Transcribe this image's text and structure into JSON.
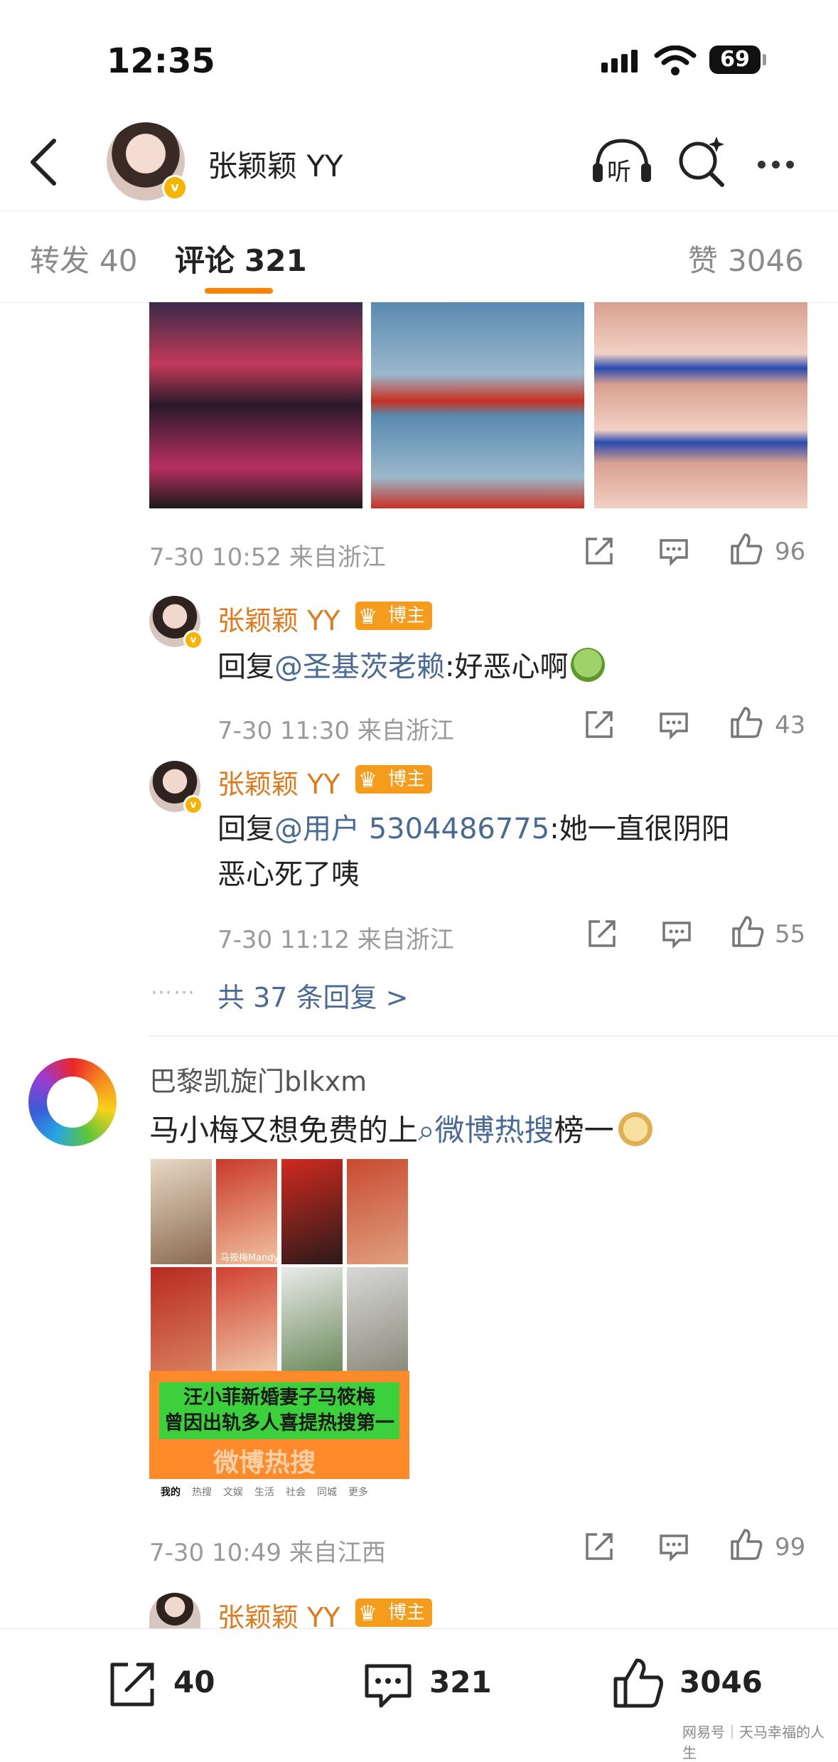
{
  "status_bar": {
    "time": "12:35",
    "battery": "69"
  },
  "header": {
    "title": "张颖颖 YY",
    "badge": "v",
    "listen_label": "听"
  },
  "tabs": [
    {
      "label": "转发",
      "count": "40"
    },
    {
      "label": "评论",
      "count": "321"
    },
    {
      "label": "赞",
      "count": "3046"
    }
  ],
  "comment1": {
    "meta": "7-30 10:52 来自浙江",
    "like_count": "96",
    "replies": [
      {
        "user": "张颖颖 YY",
        "badge": "博主",
        "reply_prefix": "回复",
        "mention": "@圣基茨老赖",
        "text": ":好恶心啊",
        "meta": "7-30 11:30 来自浙江",
        "like_count": "43"
      },
      {
        "user": "张颖颖 YY",
        "badge": "博主",
        "reply_prefix": "回复",
        "mention": "@用户 5304486775",
        "text_line1": ":她一直很阴阳",
        "text_line2": "恶心死了咦",
        "meta": "7-30 11:12 来自浙江",
        "like_count": "55"
      }
    ],
    "more_replies": "共 37 条回复 >"
  },
  "comment2": {
    "user": "巴黎凯旋门blkxm",
    "text_prefix": "马小梅又想免费的上",
    "topic": "微博热搜",
    "text_suffix": "榜一",
    "image": {
      "banner_line1": "汪小菲新婚妻子马筱梅",
      "banner_line2": "曾因出轨多人喜提热搜第一",
      "banner_sub": "微博热搜",
      "caption": "马筱梅Mandy",
      "tabs": [
        "我的",
        "热搜",
        "文娱",
        "生活",
        "社会",
        "同城",
        "更多"
      ]
    },
    "meta": "7-30 10:49 来自江西",
    "like_count": "99"
  },
  "comment3_preview": {
    "user": "张颖颖 YY",
    "badge": "博主"
  },
  "bottom_bar": {
    "repost_count": "40",
    "comment_count": "321",
    "like_count": "3046"
  },
  "watermark": "网易号｜天马幸福的人生",
  "colors": {
    "accent": "#ff8200",
    "username": "#e07a1c",
    "link": "#4a6a96"
  }
}
